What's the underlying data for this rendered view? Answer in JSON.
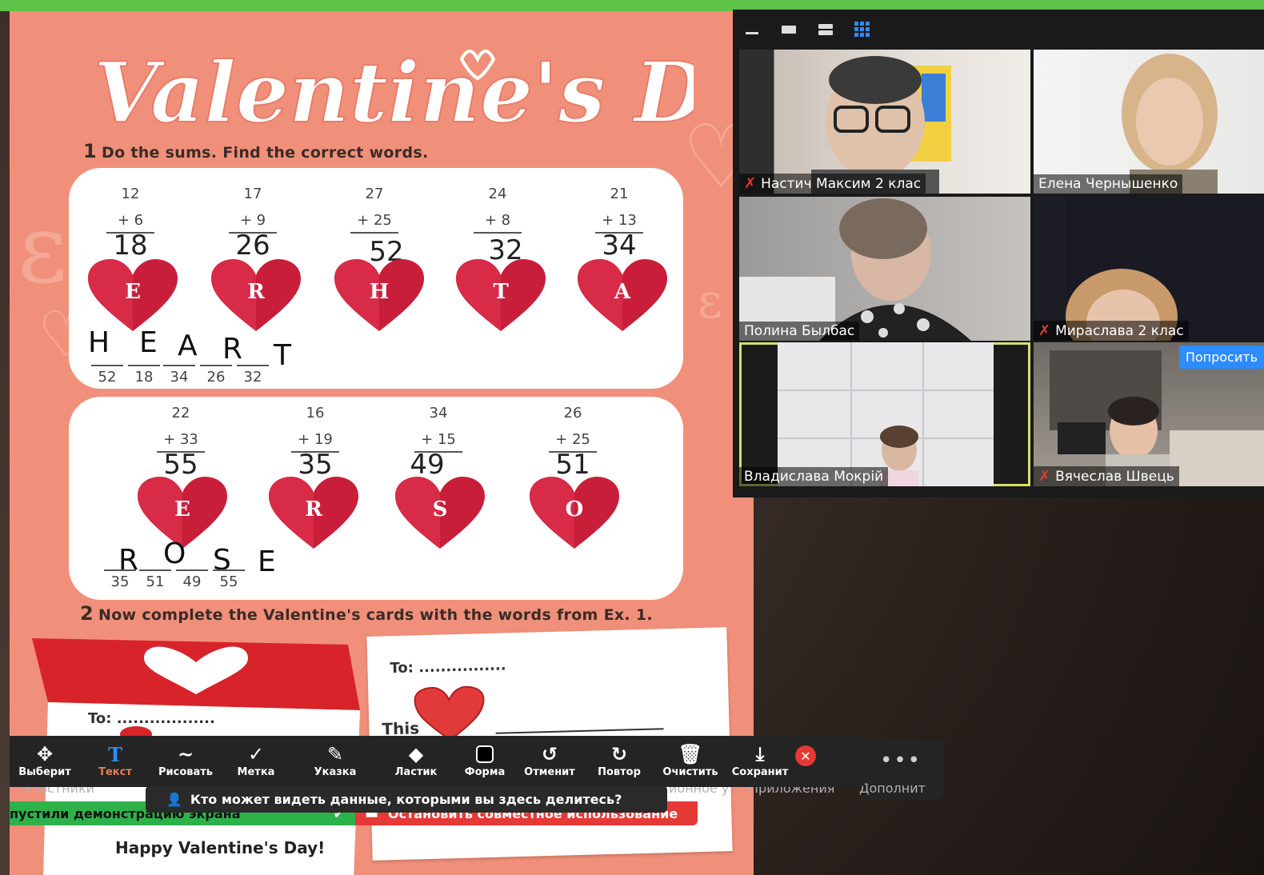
{
  "worksheet": {
    "title": "Valentine's Day",
    "ex1_num": "1",
    "ex1_text": "Do the sums. Find the correct words.",
    "ex2_num": "2",
    "ex2_text": "Now complete the Valentine's cards with the words from Ex. 1.",
    "row1": [
      {
        "a": "12",
        "b": "+  6",
        "answer": "18",
        "letter": "E"
      },
      {
        "a": "17",
        "b": "+  9",
        "answer": "26",
        "letter": "R"
      },
      {
        "a": "27",
        "b": "+ 25",
        "answer": "52",
        "letter": "H"
      },
      {
        "a": "24",
        "b": "+  8",
        "answer": "32",
        "letter": "T"
      },
      {
        "a": "21",
        "b": "+ 13",
        "answer": "34",
        "letter": "A"
      }
    ],
    "word1": {
      "letters": [
        "H",
        "E",
        "A",
        "R",
        "T"
      ],
      "codes": [
        "52",
        "18",
        "34",
        "26",
        "32"
      ]
    },
    "row2": [
      {
        "a": "22",
        "b": "+ 33",
        "answer": "55",
        "letter": "E"
      },
      {
        "a": "16",
        "b": "+ 19",
        "answer": "35",
        "letter": "R"
      },
      {
        "a": "34",
        "b": "+ 15",
        "answer": "49",
        "letter": "S"
      },
      {
        "a": "26",
        "b": "+ 25",
        "answer": "51",
        "letter": "O"
      }
    ],
    "word2": {
      "letters": [
        "R",
        "O",
        "S",
        "E"
      ],
      "codes": [
        "35",
        "51",
        "49",
        "55"
      ]
    },
    "card_red_to": "To: ..................",
    "card_red_footer": "Happy Valentine's Day!",
    "card_white_to": "To: ................",
    "card_white_this": "This"
  },
  "video": {
    "participants": [
      {
        "name": "Настич Максим 2 клас",
        "muted": true
      },
      {
        "name": "Елена Чернышенко",
        "muted": false
      },
      {
        "name": "Полина Былбас",
        "muted": false
      },
      {
        "name": "Мираслава 2 клас",
        "muted": true
      },
      {
        "name": "Владислава Мокрій",
        "muted": false
      },
      {
        "name": "Вячеслав Швець",
        "muted": true
      }
    ],
    "ask_button": "Попросить"
  },
  "annotation_toolbar": {
    "tools": [
      {
        "label": "Выберит",
        "icon": "move-icon"
      },
      {
        "label": "Текст",
        "icon": "text-icon"
      },
      {
        "label": "Рисовать",
        "icon": "draw-icon"
      },
      {
        "label": "Метка",
        "icon": "stamp-icon"
      },
      {
        "label": "Указка",
        "icon": "spotlight-icon"
      },
      {
        "label": "Ластик",
        "icon": "eraser-icon"
      },
      {
        "label": "Форма",
        "icon": "shape-icon"
      },
      {
        "label": "Отменит",
        "icon": "undo-icon"
      },
      {
        "label": "Повтор",
        "icon": "redo-icon"
      },
      {
        "label": "Очистить",
        "icon": "trash-icon"
      },
      {
        "label": "Сохранит",
        "icon": "save-icon"
      }
    ],
    "active_tool": "Текст"
  },
  "meeting_controls": {
    "participants_label": "Участники",
    "reactions_label": "ионное у",
    "apps_label": "Приложения",
    "more_label": "Дополнит"
  },
  "share_notice": "Кто может видеть данные, которыми вы здесь делитесь?",
  "share_status": "пустили демонстрацию экрана",
  "stop_share": "Остановить совместное использование"
}
